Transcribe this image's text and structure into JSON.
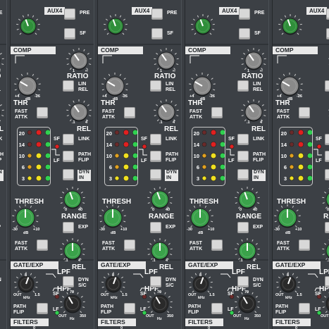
{
  "aux": {
    "label": "AUX4",
    "pre_label": "PRE",
    "sf_label": "SF"
  },
  "comp": {
    "section_label": "COMP",
    "ratio_label": "RATIO",
    "ratio_scale_min": "1",
    "ratio_scale_max": "∞",
    "thr_label": "THR",
    "thr_scale_min": "+4",
    "thr_scale_unit": "dB",
    "thr_scale_max": "-26",
    "lin_rel_label_1": "LIN",
    "lin_rel_label_2": "REL",
    "fast_attk_1": "FAST",
    "fast_attk_2": "ATTK",
    "rel_label": "REL",
    "rel_scale_min": ".1",
    "rel_scale_max": "4",
    "link_label": "LINK",
    "path_flip_1": "PATH",
    "path_flip_2": "FLIP",
    "dyn_in_1": "DYN",
    "dyn_in_2": "IN"
  },
  "meter": {
    "levels": [
      "20",
      "14",
      "10",
      "6",
      "3"
    ],
    "sf_label": "SF",
    "lf_label": "LF",
    "colors": {
      "red": "#e02020",
      "amber": "#e0a020",
      "yellow": "#f0e020",
      "green": "#30d050",
      "off": "#6a2a2a"
    }
  },
  "gate": {
    "section_label": "GATE/EXP",
    "thresh_label": "THRESH",
    "thresh_scale_min": "-30",
    "thresh_scale_unit": "dB",
    "thresh_scale_max": "+10",
    "range_label": "RANGE",
    "range_scale_min": "0",
    "range_scale_max": "40",
    "exp_label": "EXP",
    "fast_attk_1": "FAST",
    "fast_attk_2": "ATTK",
    "rel_label": "REL",
    "rel_scale_min": ".1",
    "rel_scale_max": "4"
  },
  "filters": {
    "section_label": "FILTERS",
    "lpf_label": "LPF",
    "lpf_scale_top": "8",
    "lpf_scale_out": "OUT",
    "lpf_scale_unit": "kHz",
    "lpf_scale_max": "1.5",
    "hpf_label": "HPF",
    "hpf_scale_top": "70",
    "hpf_scale_out": "OUT",
    "hpf_scale_unit": "Hz",
    "hpf_scale_max": "350",
    "dyn_sc_1": "DYN",
    "dyn_sc_2": "S/C",
    "sf_label": "SF",
    "lf_label": "LF",
    "path_flip_1": "PATH",
    "path_flip_2": "FLIP",
    "bottom_value": "0"
  },
  "colors": {
    "panel": "#3c4045",
    "aux_knob": "#2f8f3a",
    "comp_knob": "#8a8a8a",
    "gate_knob": "#3aa24a",
    "filter_knob": "#2a2a2a"
  }
}
